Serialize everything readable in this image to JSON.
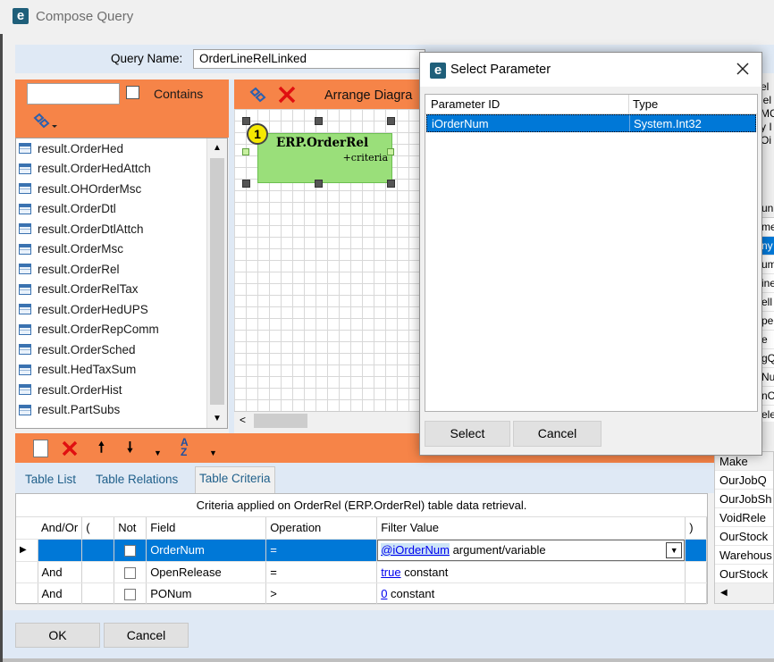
{
  "window": {
    "title": "Compose Query",
    "logo": "e"
  },
  "query_name": {
    "label": "Query Name:",
    "value": "OrderLineRelLinked"
  },
  "table_list": {
    "search_value": "",
    "contains_label": "Contains",
    "items": [
      "result.OrderHed",
      "result.OrderHedAttch",
      "result.OHOrderMsc",
      "result.OrderDtl",
      "result.OrderDtlAttch",
      "result.OrderMsc",
      "result.OrderRel",
      "result.OrderRelTax",
      "result.OrderHedUPS",
      "result.OrderRepComm",
      "result.OrderSched",
      "result.HedTaxSum",
      "result.OrderHist",
      "result.PartSubs"
    ]
  },
  "diagram": {
    "arrange_label": "Arrange Diagra",
    "node_number": "1",
    "node_title": "ERP.OrderRel",
    "node_sub": "+criteria"
  },
  "tabs": [
    "Table List",
    "Table Relations",
    "Table Criteria"
  ],
  "criteria": {
    "caption": "Criteria applied on OrderRel (ERP.OrderRel) table data retrieval.",
    "headers": [
      "And/Or",
      "(",
      "Not",
      "Field",
      "Operation",
      "Filter Value",
      ")"
    ],
    "rows": [
      {
        "andor": "",
        "field": "OrderNum",
        "op": "=",
        "link": "@iOrderNum",
        "value": "argument/variable"
      },
      {
        "andor": "And",
        "field": "OpenRelease",
        "op": "=",
        "link": "true",
        "value": "constant"
      },
      {
        "andor": "And",
        "field": "PONum",
        "op": ">",
        "link": "0",
        "value": "constant"
      }
    ]
  },
  "right_panel": {
    "top_fragments": [
      "el",
      "lel",
      "MC",
      "y I",
      "Oi"
    ],
    "header_fragment": "un",
    "mid_fragments": [
      "me",
      "ny",
      "um",
      "ine",
      "ell",
      "pe",
      "e",
      "gQ",
      "Nu",
      "nC",
      "ele",
      "ea"
    ],
    "items": [
      "Make",
      "OurJobQ",
      "OurJobSh",
      "VoidRele",
      "OurStock",
      "Warehous",
      "OurStock"
    ]
  },
  "buttons": {
    "ok": "OK",
    "cancel": "Cancel"
  },
  "dialog": {
    "title": "Select Parameter",
    "headers": [
      "Parameter ID",
      "Type"
    ],
    "rows": [
      {
        "id": "iOrderNum",
        "type": "System.Int32"
      }
    ],
    "select_label": "Select",
    "cancel_label": "Cancel"
  }
}
